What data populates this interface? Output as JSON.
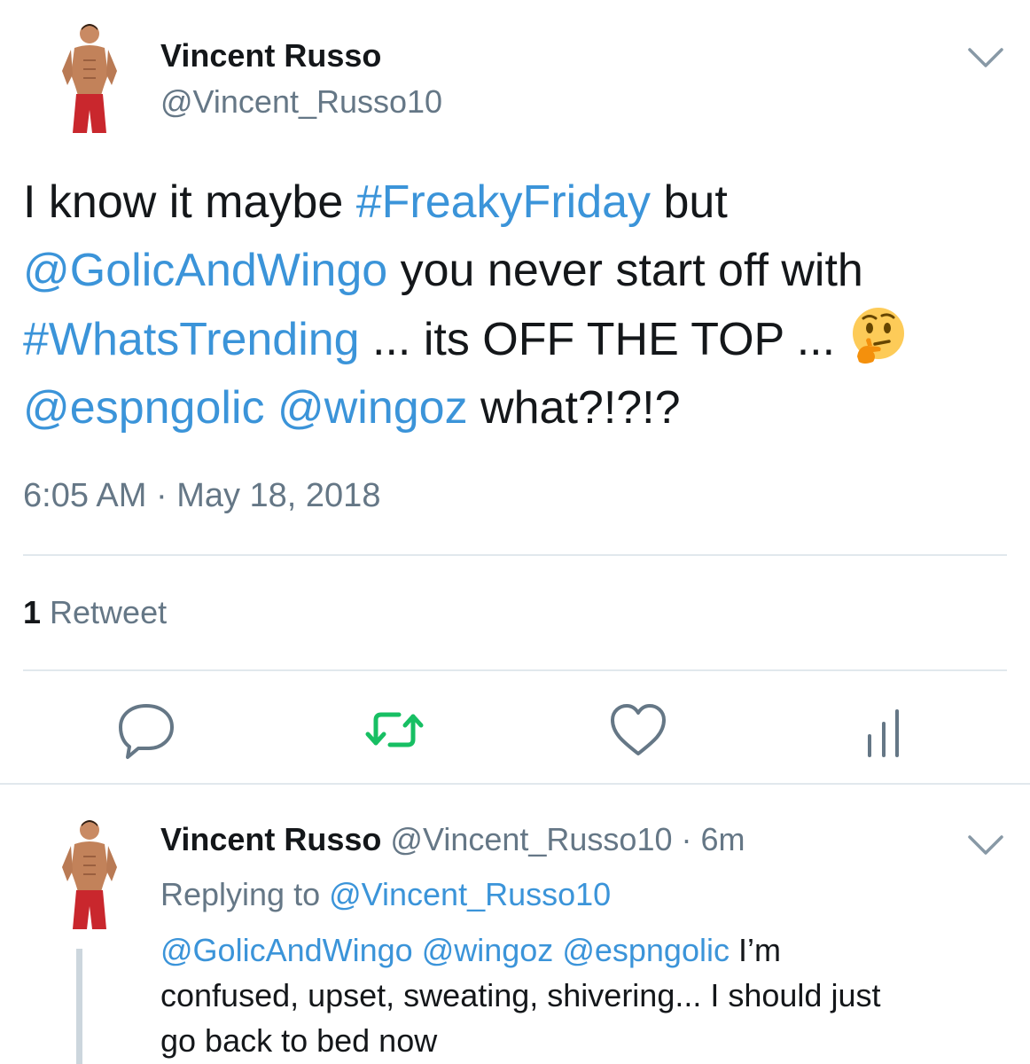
{
  "tweet": {
    "author_name": "Vincent Russo",
    "author_handle": "@Vincent_Russo10",
    "text": {
      "line1_pre": "I know it maybe ",
      "line1_tag": "#FreakyFriday",
      "line1_post": " but",
      "line2_mention": "@GolicAndWingo",
      "line2_post": " you never start off with",
      "line3_tag": "#WhatsTrending",
      "line3_post": " ... its OFF THE TOP ... ",
      "line4_mention1": "@espngolic",
      "line4_mention2": "@wingoz",
      "line4_post": " what?!?!?"
    },
    "emoji": "thinking-face",
    "timestamp": "6:05 AM · May 18, 2018",
    "retweet_count": "1",
    "retweet_label": " Retweet"
  },
  "actions": {
    "reply_icon": "reply-icon",
    "retweet_icon": "retweet-icon",
    "like_icon": "heart-icon",
    "analytics_icon": "analytics-icon"
  },
  "reply": {
    "author_name": "Vincent Russo",
    "author_handle": "@Vincent_Russo10",
    "time": "6m",
    "replying_label": "Replying to ",
    "replying_to": "@Vincent_Russo10",
    "mention1": "@GolicAndWingo",
    "mention2": "@wingoz",
    "mention3": "@espngolic",
    "line1_post": " I’m",
    "line2": "confused, upset, sweating, shivering... I should just",
    "line3": "go back to bed now"
  },
  "colors": {
    "link": "#3b94d9",
    "muted": "#657786",
    "retweet_green": "#17bf63",
    "divider": "#e1e8ed"
  }
}
